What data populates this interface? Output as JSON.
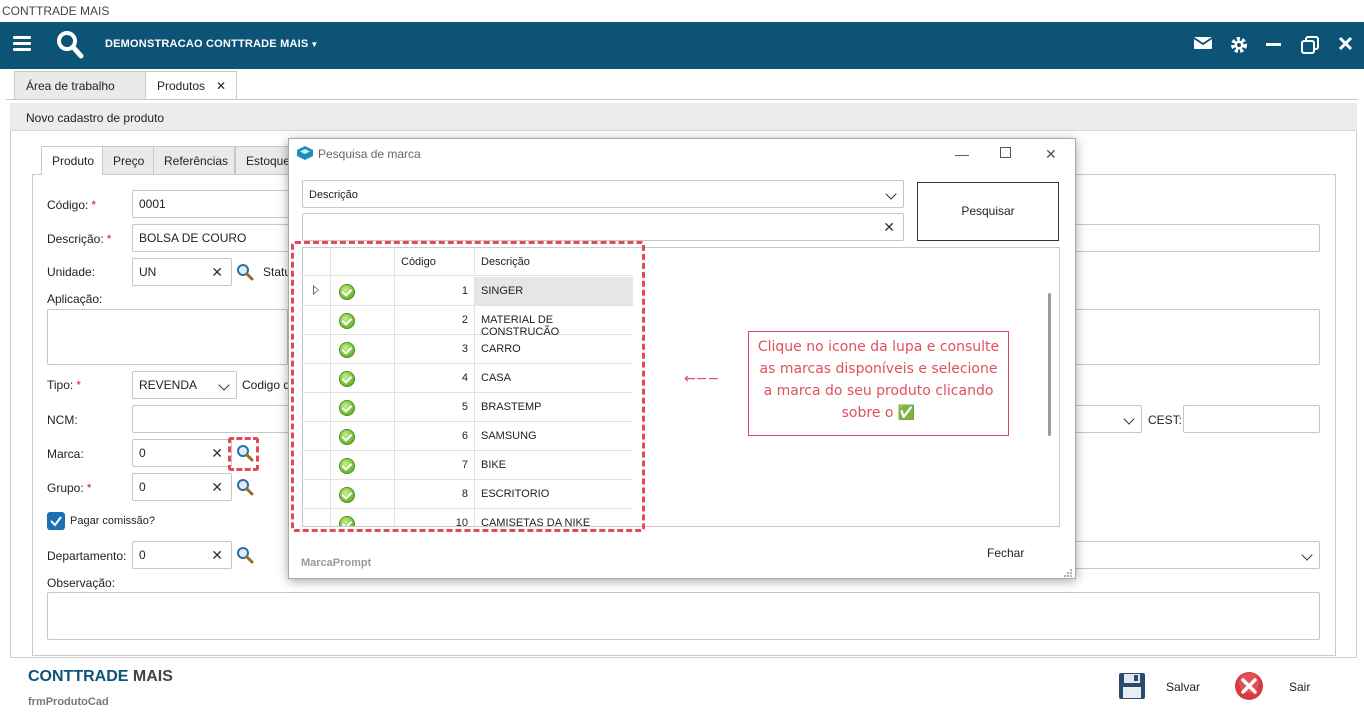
{
  "window": {
    "title": "CONTTRADE MAIS"
  },
  "topbar": {
    "company": "DEMONSTRACAO CONTTRADE MAIS",
    "bg": "#0d5376"
  },
  "main_tabs": [
    {
      "label": "Área de trabalho"
    },
    {
      "label": "Produtos",
      "close": "✕"
    }
  ],
  "form": {
    "header": "Novo cadastro de produto",
    "tabs": [
      "Produto",
      "Preço",
      "Referências",
      "Estoque"
    ],
    "fields": {
      "codigo": {
        "label": "Código:",
        "req": "*",
        "value": "0001"
      },
      "descricao": {
        "label": "Descrição:",
        "req": "*",
        "value": "BOLSA DE COURO"
      },
      "unidade": {
        "label": "Unidade:",
        "value": "UN",
        "status_label": "Statu"
      },
      "aplicacao": {
        "label": "Aplicação:"
      },
      "tipo": {
        "label": "Tipo:",
        "req": "*",
        "value": "REVENDA",
        "codigo_label": "Codigo de"
      },
      "ncm": {
        "label": "NCM:"
      },
      "cest": {
        "label": "CEST:"
      },
      "marca": {
        "label": "Marca:",
        "value": "0"
      },
      "grupo": {
        "label": "Grupo:",
        "req": "*",
        "value": "0"
      },
      "pagar_comissao": {
        "label": "Pagar comissão?",
        "checked": true
      },
      "departamento": {
        "label": "Departamento:",
        "value": "0"
      },
      "observacao": {
        "label": "Observação:"
      }
    }
  },
  "dialog": {
    "title": "Pesquisa de marca",
    "filter_select": "Descrição",
    "search_value": "",
    "search_button": "Pesquisar",
    "close_button": "Fechar",
    "footer_name": "MarcaPrompt",
    "grid": {
      "columns": [
        "Código",
        "Descrição"
      ],
      "rows": [
        {
          "codigo": "1",
          "descricao": "SINGER"
        },
        {
          "codigo": "2",
          "descricao": "MATERIAL DE CONSTRUÇÃO"
        },
        {
          "codigo": "3",
          "descricao": "CARRO"
        },
        {
          "codigo": "4",
          "descricao": "CASA"
        },
        {
          "codigo": "5",
          "descricao": "BRASTEMP"
        },
        {
          "codigo": "6",
          "descricao": "SAMSUNG"
        },
        {
          "codigo": "7",
          "descricao": "BIKE"
        },
        {
          "codigo": "8",
          "descricao": "ESCRITORIO"
        },
        {
          "codigo": "10",
          "descricao": "CAMISETAS DA NIKE"
        }
      ]
    }
  },
  "annotation": {
    "arrow": "←−−",
    "text": "Clique no icone da lupa e consulte as marcas disponíveis e selecione a marca do seu produto clicando sobre o ✅"
  },
  "footer": {
    "brand_a": "CONTTRADE",
    "brand_b": "MAIS",
    "form_id": "frmProdutoCad",
    "save": "Salvar",
    "exit": "Sair"
  }
}
